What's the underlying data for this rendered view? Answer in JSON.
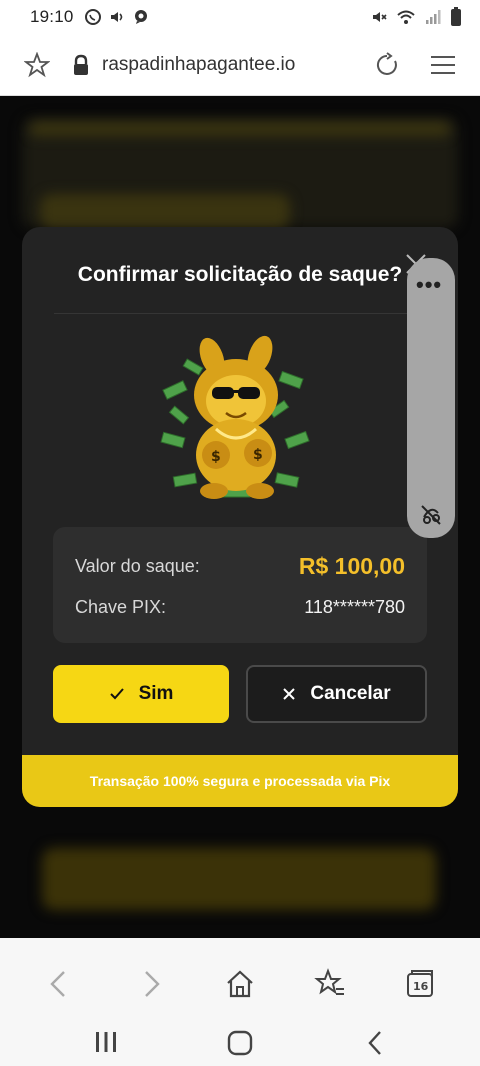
{
  "status_bar": {
    "time": "19:10"
  },
  "browser": {
    "url": "raspadinhapagantee.io",
    "tab_count": "16"
  },
  "modal": {
    "title": "Confirmar solicitação de saque?",
    "withdraw_label": "Valor do saque:",
    "withdraw_amount": "R$ 100,00",
    "pix_label": "Chave PIX:",
    "pix_key": "118******780",
    "yes_label": "Sim",
    "cancel_label": "Cancelar",
    "footer_text": "Transação 100% segura e processada via Pix"
  },
  "side_panel": {
    "menu_text": "•••"
  },
  "colors": {
    "accent": "#f6d714",
    "amount": "#f4bf2a",
    "modal_bg": "#232323"
  },
  "icons": [
    "whatsapp-icon",
    "volume-icon",
    "chat-icon",
    "mute-icon",
    "wifi-icon",
    "signal-icon",
    "battery-icon",
    "star-icon",
    "lock-icon",
    "reload-icon",
    "menu-icon",
    "close-icon",
    "check-icon",
    "x-icon",
    "back-icon",
    "forward-icon",
    "home-icon",
    "bookmarks-icon",
    "tabs-icon"
  ]
}
